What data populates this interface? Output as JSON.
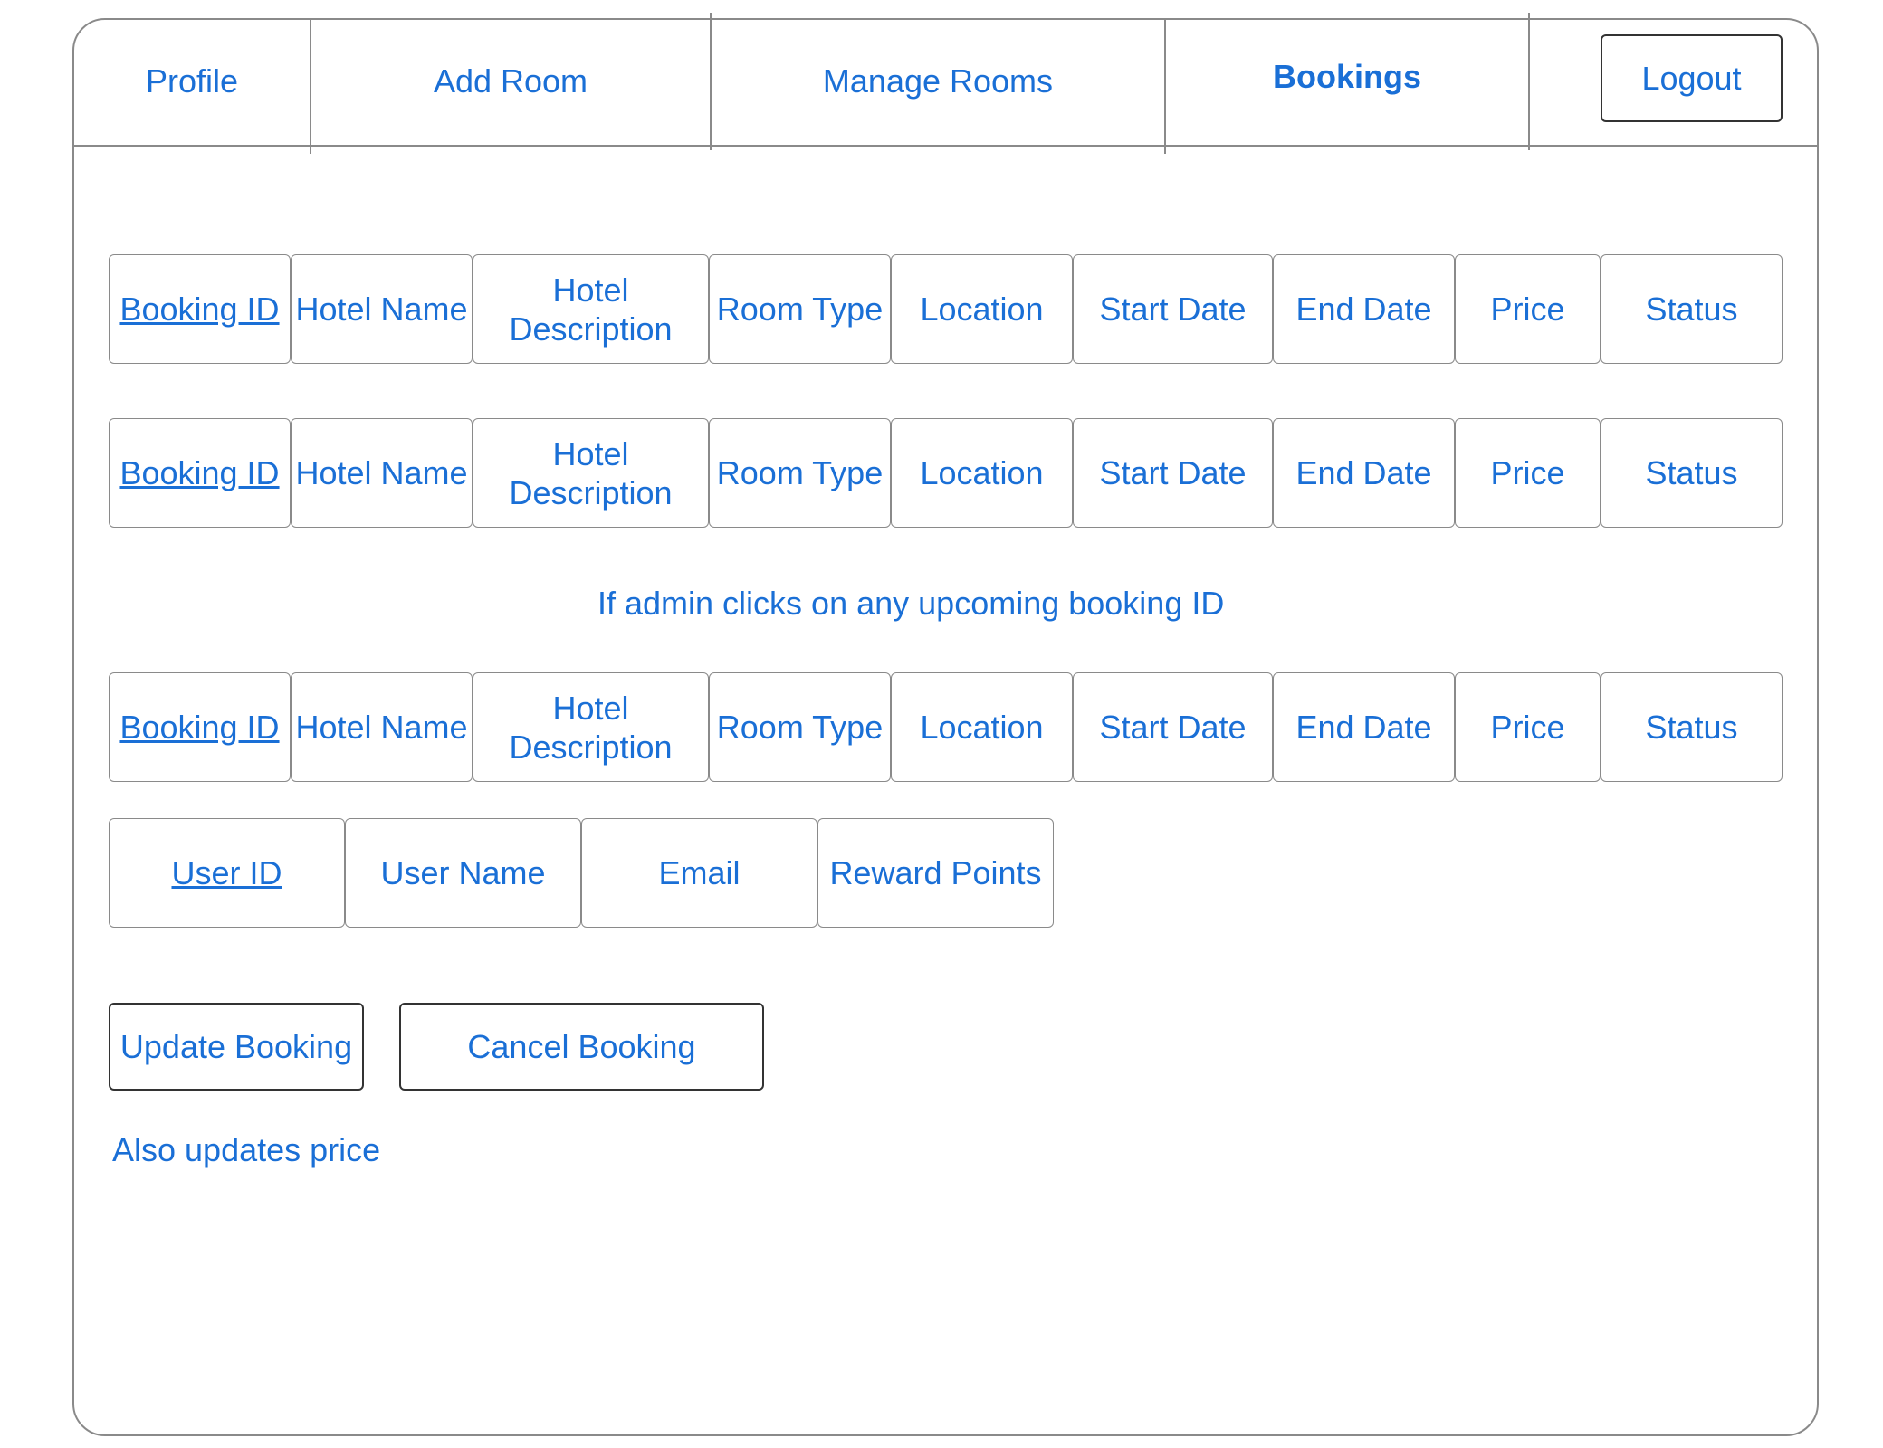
{
  "nav": {
    "items": [
      {
        "label": "Profile",
        "active": false
      },
      {
        "label": "Add Room",
        "active": false
      },
      {
        "label": "Manage Rooms",
        "active": false
      },
      {
        "label": "Bookings",
        "active": true
      }
    ],
    "logout_label": "Logout"
  },
  "booking_columns": [
    "Booking ID",
    "Hotel Name",
    "Hotel Description",
    "Room Type",
    "Location",
    "Start Date",
    "End Date",
    "Price",
    "Status"
  ],
  "booking_rows": [
    [
      "Booking ID",
      "Hotel Name",
      "Hotel Description",
      "Room Type",
      "Location",
      "Start Date",
      "End Date",
      "Price",
      "Status"
    ],
    [
      "Booking ID",
      "Hotel Name",
      "Hotel Description",
      "Room Type",
      "Location",
      "Start Date",
      "End Date",
      "Price",
      "Status"
    ]
  ],
  "admin_note": "If admin clicks on any upcoming booking ID",
  "selected_booking": [
    "Booking ID",
    "Hotel Name",
    "Hotel Description",
    "Room Type",
    "Location",
    "Start Date",
    "End Date",
    "Price",
    "Status"
  ],
  "user_row": [
    "User ID",
    "User Name",
    "Email",
    "Reward Points"
  ],
  "actions": {
    "update_label": "Update Booking",
    "cancel_label": "Cancel Booking"
  },
  "footer_note": "Also updates price",
  "colors": {
    "text": "#1a6fd6",
    "border": "#8a8a8a",
    "button_border": "#333333"
  }
}
